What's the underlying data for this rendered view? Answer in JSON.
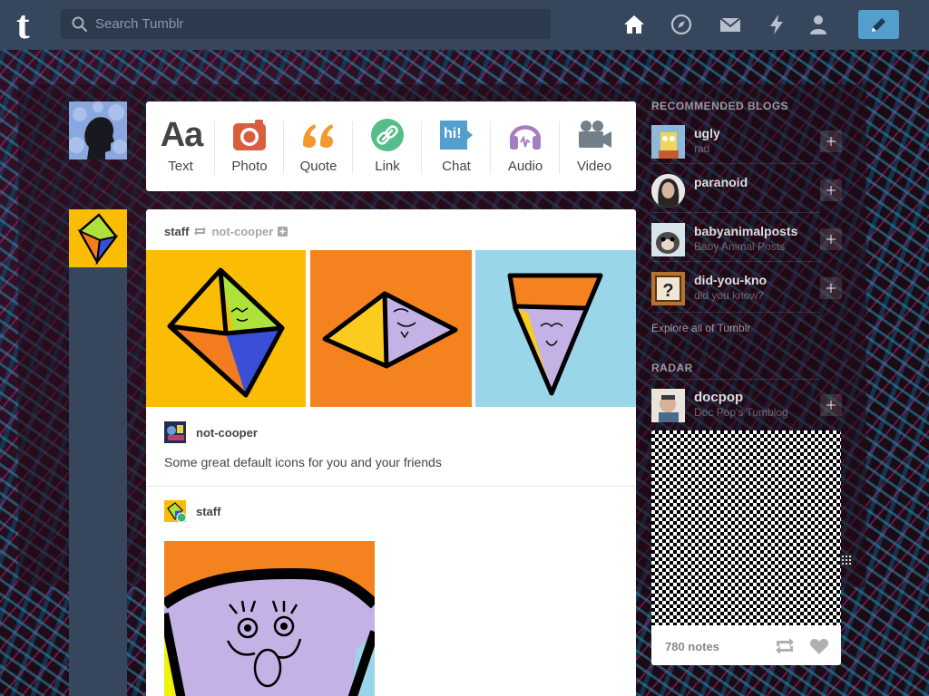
{
  "header": {
    "logo": "t",
    "search_placeholder": "Search Tumblr",
    "nav_icons": [
      "home-icon",
      "explore-icon",
      "inbox-icon",
      "activity-icon",
      "account-icon"
    ],
    "compose_icon": "pencil-icon",
    "bar_color": "#36465d",
    "compose_color": "#529ecc"
  },
  "composer": {
    "types": [
      {
        "label": "Text",
        "color": "#444444",
        "glyph": "Aa"
      },
      {
        "label": "Photo",
        "color": "#d95e40"
      },
      {
        "label": "Quote",
        "color": "#f2992e"
      },
      {
        "label": "Link",
        "color": "#56bc8a"
      },
      {
        "label": "Chat",
        "color": "#529ecc",
        "glyph": "hi!"
      },
      {
        "label": "Audio",
        "color": "#a77dc2"
      },
      {
        "label": "Video",
        "color": "#748089"
      }
    ]
  },
  "post": {
    "author": "staff",
    "reblogged_from": "not-cooper",
    "reblog_user": "not-cooper",
    "text": "Some great default icons for you and your friends",
    "original_user": "staff"
  },
  "sidebar": {
    "recommended_title": "RECOMMENDED BLOGS",
    "recommended": [
      {
        "name": "ugly",
        "subtitle": "rad"
      },
      {
        "name": "paranoid",
        "subtitle": ""
      },
      {
        "name": "babyanimalposts",
        "subtitle": "Baby Animal Posts"
      },
      {
        "name": "did-you-kno",
        "subtitle": "did you know?"
      }
    ],
    "explore": "Explore all of Tumblr",
    "radar_title": "RADAR",
    "radar": {
      "name": "docpop",
      "subtitle": "Doc Pop's Tumblog",
      "notes": "780 notes"
    }
  }
}
